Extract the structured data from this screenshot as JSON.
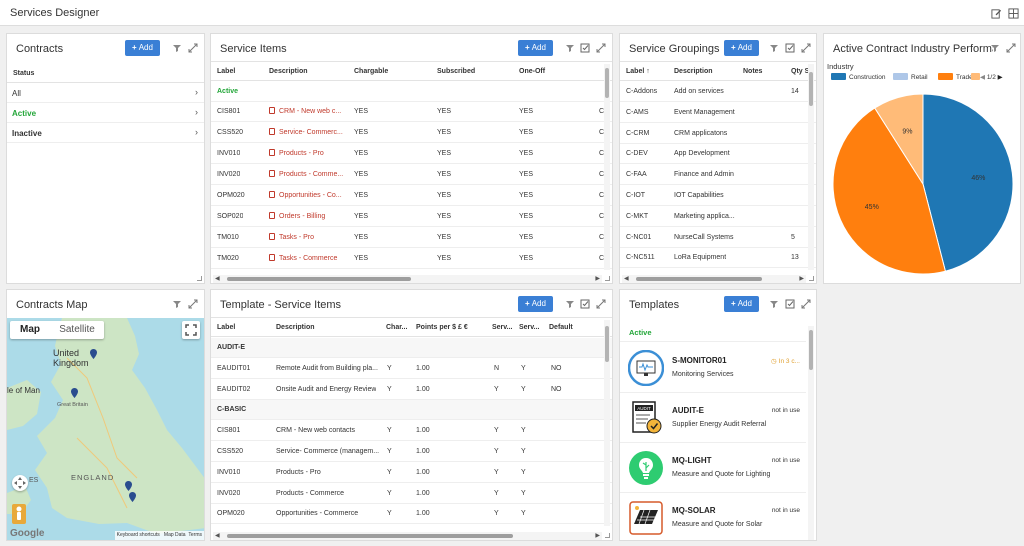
{
  "app": {
    "title": "Services Designer"
  },
  "contracts": {
    "title": "Contracts",
    "add_label": "Add",
    "column": "Status",
    "items": [
      {
        "label": "All",
        "active": false
      },
      {
        "label": "Active",
        "active": true
      },
      {
        "label": "Inactive",
        "active": false
      }
    ]
  },
  "service_items": {
    "title": "Service Items",
    "add_label": "Add",
    "columns": [
      "Label",
      "Description",
      "Chargable",
      "Subscribed",
      "One-Off"
    ],
    "group": "Active",
    "rows": [
      {
        "label": "CIS801",
        "description": "CRM - New web c...",
        "chargable": "YES",
        "subscribed": "YES",
        "oneoff": "YES"
      },
      {
        "label": "CSS520",
        "description": "Service- Commerc...",
        "chargable": "YES",
        "subscribed": "YES",
        "oneoff": "YES"
      },
      {
        "label": "INV010",
        "description": "Products - Pro",
        "chargable": "YES",
        "subscribed": "YES",
        "oneoff": "YES"
      },
      {
        "label": "INV020",
        "description": "Products - Comme...",
        "chargable": "YES",
        "subscribed": "YES",
        "oneoff": "YES"
      },
      {
        "label": "OPM020",
        "description": "Opportunities - Co...",
        "chargable": "YES",
        "subscribed": "YES",
        "oneoff": "YES"
      },
      {
        "label": "SOP020",
        "description": "Orders - Billing",
        "chargable": "YES",
        "subscribed": "YES",
        "oneoff": "YES"
      },
      {
        "label": "TM010",
        "description": "Tasks - Pro",
        "chargable": "YES",
        "subscribed": "YES",
        "oneoff": "YES"
      },
      {
        "label": "TM020",
        "description": "Tasks - Commerce",
        "chargable": "YES",
        "subscribed": "YES",
        "oneoff": "YES"
      }
    ]
  },
  "service_groupings": {
    "title": "Service Groupings",
    "add_label": "Add",
    "columns": [
      "Label",
      "Description",
      "Notes",
      "Qty S"
    ],
    "rows": [
      {
        "label": "C-Addons",
        "description": "Add on services",
        "notes": "",
        "qty": "14"
      },
      {
        "label": "C-AMS",
        "description": "Event Management",
        "notes": "",
        "qty": ""
      },
      {
        "label": "C-CRM",
        "description": "CRM applicatons",
        "notes": "",
        "qty": ""
      },
      {
        "label": "C-DEV",
        "description": "App Development",
        "notes": "",
        "qty": ""
      },
      {
        "label": "C-FAA",
        "description": "Finance and Admin",
        "notes": "",
        "qty": ""
      },
      {
        "label": "C-IOT",
        "description": "IOT Capabilities",
        "notes": "",
        "qty": ""
      },
      {
        "label": "C-MKT",
        "description": "Marketing applica...",
        "notes": "",
        "qty": ""
      },
      {
        "label": "C-NC01",
        "description": "NurseCall Systems",
        "notes": "",
        "qty": "5"
      },
      {
        "label": "C-NC511",
        "description": "LoRa Equipment",
        "notes": "",
        "qty": "13"
      }
    ]
  },
  "industry_chart": {
    "title": "Active Contract Industry Performan",
    "legend_title": "Industry",
    "page": "1/2"
  },
  "chart_data": {
    "type": "pie",
    "title": "Active Contract Industry Performan",
    "legend_title": "Industry",
    "slices": [
      {
        "name": "Construction",
        "value": 46,
        "label": "46%",
        "color": "#1f77b4"
      },
      {
        "name": "Trade",
        "value": 45,
        "label": "45%",
        "color": "#ff7f0e"
      },
      {
        "name": "",
        "value": 9,
        "label": "9%",
        "color": "#ffbb78"
      }
    ],
    "legend": [
      {
        "name": "Construction",
        "color": "#1f77b4"
      },
      {
        "name": "Retail",
        "color": "#aec7e8"
      },
      {
        "name": "Trade",
        "color": "#ff7f0e"
      },
      {
        "name": "",
        "color": "#ffbb78"
      }
    ],
    "legend_placement": "top"
  },
  "contracts_map": {
    "title": "Contracts Map",
    "map_tab": "Map",
    "satellite_tab": "Satellite",
    "labels": {
      "uk": "United Kingdom",
      "iom": "le of Man",
      "gb": "Great Britain",
      "eng": "ENGLAND",
      "es": "ES"
    },
    "footer": [
      "Keyboard shortcuts",
      "Map Data",
      "Terms"
    ],
    "google": "Google"
  },
  "template_service_items": {
    "title": "Template - Service Items",
    "add_label": "Add",
    "columns": [
      "Label",
      "Description",
      "Char...",
      "Points per $ £ €",
      "Serv...",
      "Serv...",
      "Default"
    ],
    "groups": [
      {
        "name": "AUDIT-E",
        "rows": [
          {
            "label": "EAUDIT01",
            "description": "Remote Audit from Building pla...",
            "char": "Y",
            "points": "1.00",
            "s1": "N",
            "s2": "Y",
            "def": "NO"
          },
          {
            "label": "EAUDIT02",
            "description": "Onsite Audit and Energy Review",
            "char": "Y",
            "points": "1.00",
            "s1": "Y",
            "s2": "Y",
            "def": "NO"
          }
        ]
      },
      {
        "name": "C-BASIC",
        "rows": [
          {
            "label": "CIS801",
            "description": "CRM - New web contacts",
            "char": "Y",
            "points": "1.00",
            "s1": "Y",
            "s2": "Y",
            "def": ""
          },
          {
            "label": "CSS520",
            "description": "Service- Commerce (managem...",
            "char": "Y",
            "points": "1.00",
            "s1": "Y",
            "s2": "Y",
            "def": ""
          },
          {
            "label": "INV010",
            "description": "Products - Pro",
            "char": "Y",
            "points": "1.00",
            "s1": "Y",
            "s2": "Y",
            "def": ""
          },
          {
            "label": "INV020",
            "description": "Products - Commerce",
            "char": "Y",
            "points": "1.00",
            "s1": "Y",
            "s2": "Y",
            "def": ""
          },
          {
            "label": "OPM020",
            "description": "Opportunities - Commerce",
            "char": "Y",
            "points": "1.00",
            "s1": "Y",
            "s2": "Y",
            "def": ""
          }
        ]
      }
    ]
  },
  "templates": {
    "title": "Templates",
    "add_label": "Add",
    "group": "Active",
    "items": [
      {
        "code": "S-MONITOR01",
        "desc": "Monitoring Services",
        "status": "In 3 c...",
        "status_color": "#e0a030",
        "icon": "monitor-icon"
      },
      {
        "code": "AUDIT-E",
        "desc": "Supplier Energy Audit Referral",
        "status": "not in use",
        "status_color": "#333333",
        "icon": "audit-icon"
      },
      {
        "code": "MQ-LIGHT",
        "desc": "Measure and Quote for Lighting",
        "status": "not in use",
        "status_color": "#333333",
        "icon": "lightbulb-icon"
      },
      {
        "code": "MQ-SOLAR",
        "desc": "Measure and Quote for Solar",
        "status": "not in use",
        "status_color": "#333333",
        "icon": "solar-panel-icon"
      }
    ]
  }
}
